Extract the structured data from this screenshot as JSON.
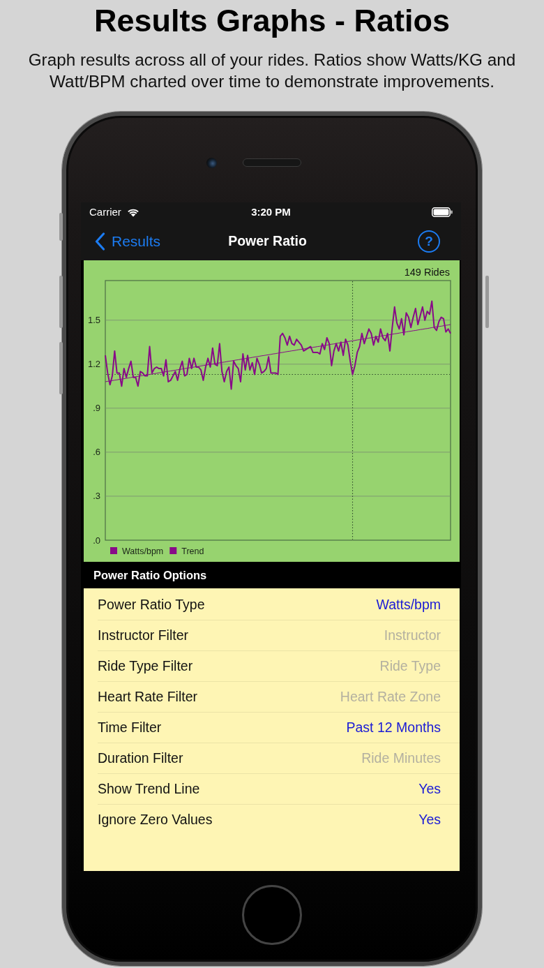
{
  "header": {
    "title": "Results Graphs - Ratios",
    "subtitle": "Graph results across all of your rides. Ratios show Watts/KG and Watt/BPM charted over time to demonstrate improvements."
  },
  "status_bar": {
    "carrier": "Carrier",
    "time": "3:20 PM"
  },
  "nav_bar": {
    "back": "Results",
    "title": "Power Ratio",
    "help": "?"
  },
  "chart": {
    "ride_count": "149 Rides",
    "chart_data": {
      "type": "line",
      "ylim": [
        0,
        1.77
      ],
      "yticks": [
        {
          "value": 0,
          "label": ".0"
        },
        {
          "value": 0.3,
          "label": ".3"
        },
        {
          "value": 0.6,
          "label": ".6"
        },
        {
          "value": 0.9,
          "label": ".9"
        },
        {
          "value": 1.2,
          "label": "1.2"
        },
        {
          "value": 1.5,
          "label": "1.5"
        }
      ],
      "grid": true,
      "legend": "bottom-left",
      "series": [
        {
          "name": "Watts/bpm",
          "color": "#880a88",
          "values": [
            1.26,
            1.14,
            1.06,
            1.12,
            1.29,
            1.14,
            1.14,
            1.05,
            1.17,
            1.11,
            1.17,
            1.22,
            1.11,
            1.11,
            1.05,
            1.15,
            1.14,
            1.12,
            1.12,
            1.32,
            1.14,
            1.17,
            1.18,
            1.17,
            1.17,
            1.12,
            1.23,
            1.08,
            1.09,
            1.12,
            1.15,
            1.09,
            1.17,
            1.22,
            1.12,
            1.13,
            1.24,
            1.17,
            1.24,
            1.18,
            1.18,
            1.16,
            1.09,
            1.18,
            1.24,
            1.18,
            1.31,
            1.2,
            1.19,
            1.34,
            1.15,
            1.08,
            1.15,
            1.18,
            1.03,
            1.22,
            1.19,
            1.17,
            1.08,
            1.27,
            1.16,
            1.26,
            1.16,
            1.21,
            1.13,
            1.24,
            1.2,
            1.14,
            1.15,
            1.17,
            1.25,
            1.14,
            1.14,
            1.14,
            1.13,
            1.39,
            1.41,
            1.38,
            1.33,
            1.39,
            1.34,
            1.33,
            1.37,
            1.35,
            1.33,
            1.29,
            1.3,
            1.31,
            1.32,
            1.28,
            1.28,
            1.28,
            1.27,
            1.34,
            1.3,
            1.38,
            1.34,
            1.19,
            1.29,
            1.34,
            1.29,
            1.35,
            1.26,
            1.37,
            1.33,
            1.22,
            1.13,
            1.19,
            1.28,
            1.32,
            1.41,
            1.34,
            1.39,
            1.44,
            1.41,
            1.33,
            1.39,
            1.35,
            1.44,
            1.38,
            1.36,
            1.41,
            1.29,
            1.45,
            1.59,
            1.48,
            1.44,
            1.51,
            1.4,
            1.55,
            1.52,
            1.45,
            1.52,
            1.58,
            1.47,
            1.53,
            1.59,
            1.5,
            1.56,
            1.54,
            1.63,
            1.45,
            1.43,
            1.49,
            1.52,
            1.51,
            1.42,
            1.44,
            1.41
          ]
        },
        {
          "name": "Trend",
          "color": "#880a88",
          "values": [
            1.08,
            1.083,
            1.085,
            1.088,
            1.091,
            1.093,
            1.096,
            1.098,
            1.101,
            1.104,
            1.106,
            1.109,
            1.112,
            1.114,
            1.117,
            1.12,
            1.122,
            1.125,
            1.127,
            1.13,
            1.133,
            1.135,
            1.138,
            1.141,
            1.143,
            1.146,
            1.149,
            1.151,
            1.154,
            1.156,
            1.159,
            1.162,
            1.164,
            1.167,
            1.17,
            1.172,
            1.175,
            1.177,
            1.18,
            1.183,
            1.185,
            1.188,
            1.191,
            1.193,
            1.196,
            1.199,
            1.201,
            1.204,
            1.206,
            1.209,
            1.212,
            1.214,
            1.217,
            1.22,
            1.222,
            1.225,
            1.228,
            1.23,
            1.233,
            1.235,
            1.238,
            1.241,
            1.243,
            1.246,
            1.249,
            1.251,
            1.254,
            1.257,
            1.259,
            1.262,
            1.264,
            1.267,
            1.27,
            1.272,
            1.275,
            1.278,
            1.28,
            1.283,
            1.286,
            1.288,
            1.291,
            1.293,
            1.296,
            1.299,
            1.301,
            1.304,
            1.307,
            1.309,
            1.312,
            1.315,
            1.317,
            1.32,
            1.322,
            1.325,
            1.328,
            1.33,
            1.333,
            1.336,
            1.338,
            1.341,
            1.344,
            1.346,
            1.349,
            1.351,
            1.354,
            1.357,
            1.359,
            1.362,
            1.365,
            1.367,
            1.37,
            1.372,
            1.375,
            1.378,
            1.38,
            1.383,
            1.386,
            1.388,
            1.391,
            1.394,
            1.396,
            1.399,
            1.401,
            1.404,
            1.407,
            1.409,
            1.412,
            1.415,
            1.417,
            1.42,
            1.423,
            1.425,
            1.428,
            1.43,
            1.433,
            1.436,
            1.438,
            1.441,
            1.443,
            1.446,
            1.449,
            1.452,
            1.454,
            1.457,
            1.459,
            1.462,
            1.465,
            1.467,
            1.47
          ]
        }
      ],
      "ref_lines": [
        {
          "axis": "y",
          "value": 1.13
        }
      ]
    }
  },
  "options": {
    "header": "Power Ratio Options",
    "rows": [
      {
        "label": "Power Ratio Type",
        "value": "Watts/bpm"
      },
      {
        "label": "Instructor Filter",
        "placeholder": "Instructor"
      },
      {
        "label": "Ride Type Filter",
        "placeholder": "Ride Type"
      },
      {
        "label": "Heart Rate Filter",
        "placeholder": "Heart Rate Zone"
      },
      {
        "label": "Time Filter",
        "value": "Past 12 Months"
      },
      {
        "label": "Duration Filter",
        "placeholder": "Ride Minutes"
      },
      {
        "label": "Show Trend Line",
        "value": "Yes"
      },
      {
        "label": "Ignore Zero Values",
        "value": "Yes"
      }
    ]
  }
}
